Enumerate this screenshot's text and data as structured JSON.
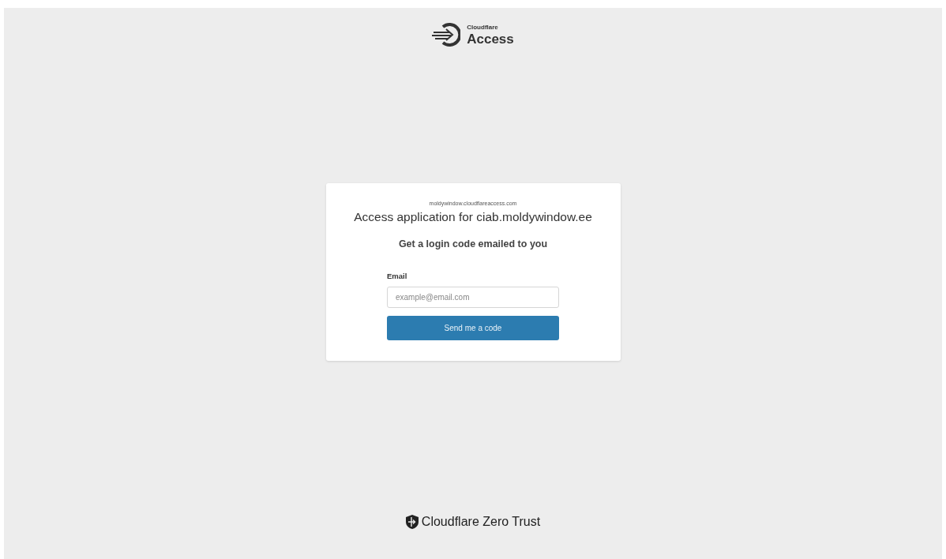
{
  "header": {
    "brand_small": "Cloudflare",
    "brand_large": "Access"
  },
  "card": {
    "domain": "moldywindow.cloudflareaccess.com",
    "title": "Access application for ciab.moldywindow.ee",
    "subtitle": "Get a login code emailed to you",
    "email_label": "Email",
    "email_placeholder": "example@email.com",
    "submit": "Send me a code"
  },
  "footer": {
    "brand": "Cloudflare Zero Trust"
  }
}
